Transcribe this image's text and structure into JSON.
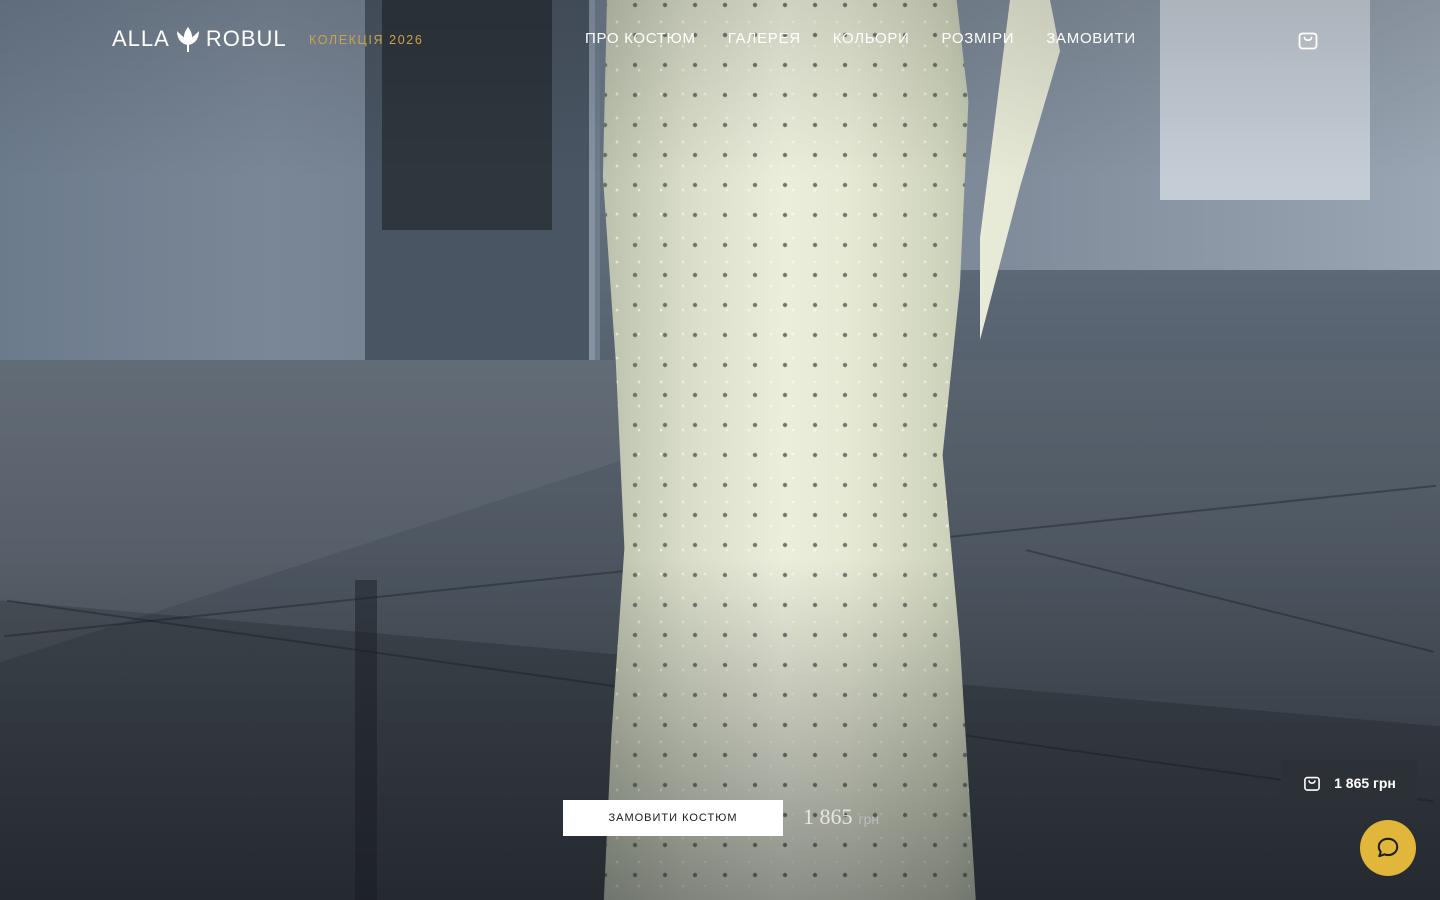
{
  "brand": {
    "logo_left": "ALLA",
    "logo_right": "ROBUL",
    "collection": "КОЛЕКЦІЯ 2026"
  },
  "nav": {
    "items": [
      {
        "label": "ПРО КОСТЮМ"
      },
      {
        "label": "ГАЛЕРЕЯ"
      },
      {
        "label": "КОЛЬОРИ"
      },
      {
        "label": "РОЗМІРИ"
      },
      {
        "label": "ЗАМОВИТИ"
      }
    ]
  },
  "hero": {
    "order_button": "ЗАМОВИТИ КОСТЮМ",
    "price_amount": "1 865",
    "price_currency": "грн"
  },
  "cart_summary": {
    "total": "1 865 грн"
  },
  "icons": {
    "cart": "shopping-bag-icon",
    "chat": "chat-bubble-icon",
    "logo_mark": "tulip-icon"
  },
  "colors": {
    "accent_gold": "#c9a24a",
    "chat_button": "#e2b63a",
    "cart_summary_bg": "#2b3137",
    "button_bg": "#ffffff"
  }
}
